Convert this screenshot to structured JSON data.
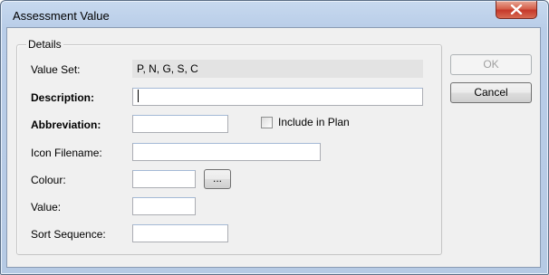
{
  "window": {
    "title": "Assessment Value",
    "close_icon": "close-icon"
  },
  "details": {
    "legend": "Details",
    "value_set": {
      "label": "Value Set:",
      "value": "P, N, G, S, C"
    },
    "description": {
      "label": "Description:",
      "value": ""
    },
    "abbreviation": {
      "label": "Abbreviation:",
      "value": ""
    },
    "include_in_plan": {
      "label": "Include in Plan",
      "checked": false
    },
    "icon_filename": {
      "label": "Icon Filename:",
      "value": ""
    },
    "colour": {
      "label": "Colour:",
      "value": "",
      "browse_label": "..."
    },
    "value": {
      "label": "Value:",
      "value": ""
    },
    "sort_sequence": {
      "label": "Sort Sequence:",
      "value": ""
    }
  },
  "buttons": {
    "ok": "OK",
    "cancel": "Cancel"
  },
  "colors": {
    "title_bar": "#b9cde8",
    "client_bg": "#f0f0f0",
    "close_button": "#c5382a"
  }
}
